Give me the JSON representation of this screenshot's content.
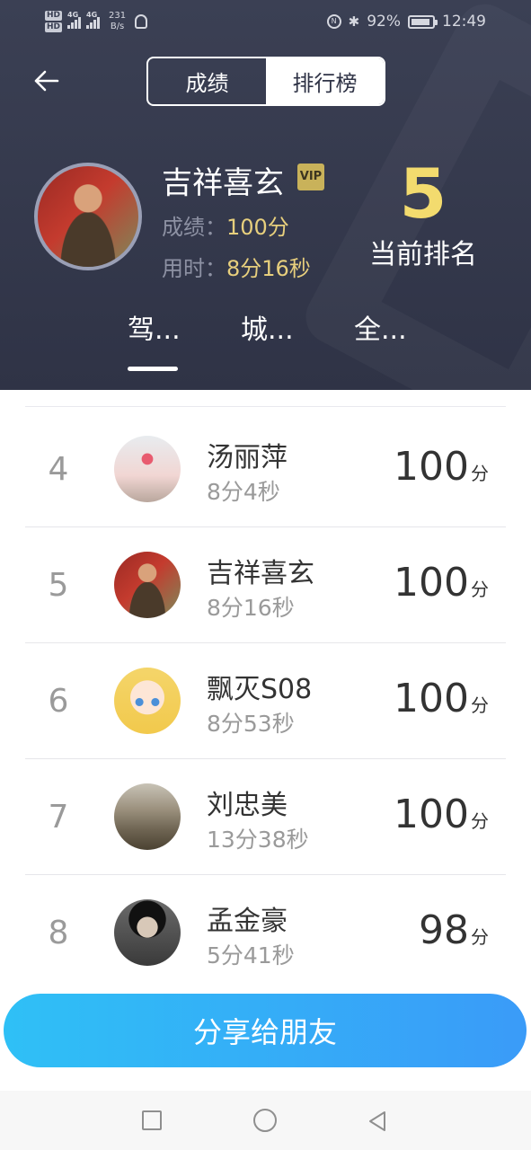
{
  "status_bar": {
    "hd1": "HD",
    "hd2": "HD",
    "sig1_label": "4G",
    "sig2_label": "4G",
    "net_speed_value": "231",
    "net_speed_unit": "B/s",
    "vibrate_label": "N",
    "battery_percent": "92%",
    "battery_level": 0.92,
    "time": "12:49"
  },
  "header": {
    "tabs": [
      {
        "label": "成绩",
        "active": false
      },
      {
        "label": "排行榜",
        "active": true
      }
    ],
    "user": {
      "name": "吉祥喜玄",
      "vip_label": "VIP",
      "score_label": "成绩：",
      "score_value": "100分",
      "time_label": "用时：",
      "time_value": "8分16秒"
    },
    "rank": {
      "number": "5",
      "label": "当前排名"
    },
    "category_tabs": [
      {
        "label": "驾...",
        "active": true
      },
      {
        "label": "城...",
        "active": false
      },
      {
        "label": "全...",
        "active": false
      }
    ]
  },
  "leaderboard": [
    {
      "rank": "4",
      "name": "汤丽萍",
      "time": "8分4秒",
      "score": "100",
      "unit": "分"
    },
    {
      "rank": "5",
      "name": "吉祥喜玄",
      "time": "8分16秒",
      "score": "100",
      "unit": "分"
    },
    {
      "rank": "6",
      "name": "飘灭S08",
      "time": "8分53秒",
      "score": "100",
      "unit": "分"
    },
    {
      "rank": "7",
      "name": "刘忠美",
      "time": "13分38秒",
      "score": "100",
      "unit": "分"
    },
    {
      "rank": "8",
      "name": "孟金豪",
      "time": "5分41秒",
      "score": "98",
      "unit": "分"
    }
  ],
  "share_button": {
    "label": "分享给朋友"
  },
  "colors": {
    "header_bg": "#3b4054",
    "accent_gold": "#f3db6e",
    "share_gradient_start": "#2fc0f6",
    "share_gradient_end": "#3a9bf8"
  },
  "icons": {
    "back": "arrow-left-icon",
    "vip": "vip-badge-icon",
    "nav_recents": "square-icon",
    "nav_home": "circle-icon",
    "nav_back": "triangle-back-icon"
  }
}
